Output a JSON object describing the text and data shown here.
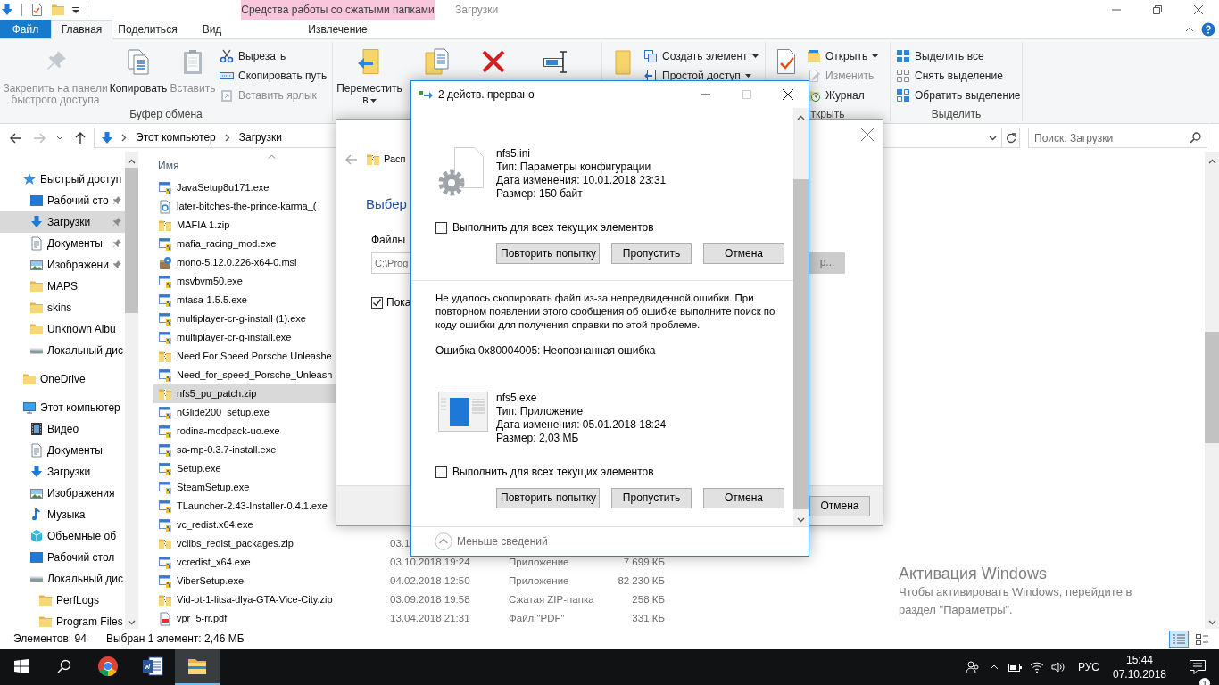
{
  "window": {
    "context_tab_group": "Средства работы со сжатыми папками",
    "title": "Загрузки"
  },
  "ribbon": {
    "tabs": [
      {
        "label": "Файл",
        "kind": "file",
        "selected": false
      },
      {
        "label": "Главная",
        "kind": "tab",
        "selected": true
      },
      {
        "label": "Поделиться",
        "kind": "tab",
        "selected": false
      },
      {
        "label": "Вид",
        "kind": "tab",
        "selected": false
      },
      {
        "label": "Извлечение",
        "kind": "context",
        "selected": false
      }
    ],
    "groups": [
      {
        "label": "Буфер обмена",
        "items": [
          {
            "kind": "large",
            "label": "Закрепить на панели быстрого доступа",
            "disabled": true,
            "dropdown": false
          },
          {
            "kind": "large",
            "label": "Копировать",
            "disabled": false,
            "dropdown": false
          },
          {
            "kind": "large",
            "label": "Вставить",
            "disabled": true,
            "dropdown": false
          },
          {
            "kind": "small",
            "label": "Вырезать",
            "disabled": false,
            "dropdown": false
          },
          {
            "kind": "small",
            "label": "Скопировать путь",
            "disabled": false,
            "dropdown": false
          },
          {
            "kind": "small",
            "label": "Вставить ярлык",
            "disabled": true,
            "dropdown": false
          }
        ]
      },
      {
        "items": [
          {
            "kind": "large",
            "label": "Переместить в",
            "disabled": false,
            "dropdown": true
          },
          {
            "kind": "large"
          },
          {
            "kind": "large"
          },
          {
            "kind": "large"
          }
        ]
      },
      {
        "items": [
          {
            "kind": "large"
          },
          {
            "kind": "small",
            "label": "Создать элемент",
            "disabled": false,
            "dropdown": true
          },
          {
            "kind": "small",
            "label": "Простой доступ",
            "disabled": false,
            "dropdown": true
          }
        ]
      },
      {
        "label": "ткрыть",
        "items": [
          {
            "kind": "large"
          },
          {
            "kind": "small",
            "label": "Открыть",
            "disabled": false,
            "dropdown": true
          },
          {
            "kind": "small",
            "label": "Изменить",
            "disabled": true,
            "dropdown": false
          },
          {
            "kind": "small",
            "label": "Журнал",
            "disabled": false,
            "dropdown": false
          }
        ]
      },
      {
        "label": "Выделить",
        "items": [
          {
            "kind": "small",
            "label": "Выделить все",
            "disabled": false,
            "dropdown": false
          },
          {
            "kind": "small",
            "label": "Снять выделение",
            "disabled": false,
            "dropdown": false
          },
          {
            "kind": "small",
            "label": "Обратить выделение",
            "disabled": false,
            "dropdown": false
          }
        ]
      }
    ]
  },
  "address": {
    "parts": [
      "Этот компьютер",
      "Загрузки"
    ],
    "search_placeholder": "Поиск: Загрузки"
  },
  "nav": {
    "items": [
      {
        "label": "Быстрый доступ",
        "kind": "star",
        "selected": false,
        "children": [
          {
            "label": "Рабочий сто",
            "kind": "desktop",
            "pinned": true,
            "selected": false
          },
          {
            "label": "Загрузки",
            "kind": "download",
            "pinned": true,
            "selected": true
          },
          {
            "label": "Документы",
            "kind": "documents",
            "pinned": true,
            "selected": false
          },
          {
            "label": "Изображени",
            "kind": "pictures",
            "pinned": true,
            "selected": false
          },
          {
            "label": "MAPS",
            "kind": "folder",
            "pinned": false,
            "selected": false
          },
          {
            "label": "skins",
            "kind": "folder",
            "pinned": false,
            "selected": false
          },
          {
            "label": "Unknown Albu",
            "kind": "folder",
            "pinned": false,
            "selected": false
          },
          {
            "label": "Локальный дис",
            "kind": "drive",
            "pinned": false,
            "selected": false
          }
        ]
      },
      {
        "label": "OneDrive",
        "kind": "folder",
        "selected": false
      },
      {
        "label": "Этот компьютер",
        "kind": "pc",
        "selected": false,
        "children": [
          {
            "label": "Видео",
            "kind": "video",
            "selected": false
          },
          {
            "label": "Документы",
            "kind": "documents",
            "selected": false
          },
          {
            "label": "Загрузки",
            "kind": "download",
            "selected": false
          },
          {
            "label": "Изображения",
            "kind": "pictures",
            "selected": false
          },
          {
            "label": "Музыка",
            "kind": "music",
            "selected": false
          },
          {
            "label": "Объемные об",
            "kind": "cube",
            "selected": false
          },
          {
            "label": "Рабочий стол",
            "kind": "desktop",
            "selected": false
          },
          {
            "label": "Локальный дис",
            "kind": "drive",
            "selected": false,
            "children": [
              {
                "label": "PerfLogs",
                "kind": "folder",
                "selected": false
              },
              {
                "label": "Program Files",
                "kind": "folder",
                "selected": false
              }
            ]
          }
        ]
      }
    ]
  },
  "file_list": {
    "name_column": "Имя"
  },
  "files": [
    {
      "name": "JavaSetup8u171.exe",
      "kind": "exe",
      "selected": false
    },
    {
      "name": "later-bitches-the-prince-karma_(",
      "kind": "web",
      "selected": false
    },
    {
      "name": "MAFIA 1.zip",
      "kind": "zip",
      "selected": false
    },
    {
      "name": "mafia_racing_mod.exe",
      "kind": "exe",
      "selected": false
    },
    {
      "name": "mono-5.12.0.226-x64-0.msi",
      "kind": "msi",
      "selected": false
    },
    {
      "name": "msvbvm50.exe",
      "kind": "exe",
      "selected": false
    },
    {
      "name": "mtasa-1.5.5.exe",
      "kind": "exe",
      "selected": false
    },
    {
      "name": "multiplayer-cr-g-install (1).exe",
      "kind": "exe",
      "selected": false
    },
    {
      "name": "multiplayer-cr-g-install.exe",
      "kind": "exe",
      "selected": false
    },
    {
      "name": "Need For Speed Porsche Unleashe",
      "kind": "zip",
      "selected": false
    },
    {
      "name": "Need_for_speed_Porsche_Unleash",
      "kind": "exe",
      "selected": false
    },
    {
      "name": "nfs5_pu_patch.zip",
      "kind": "zip",
      "selected": true
    },
    {
      "name": "nGlide200_setup.exe",
      "kind": "exe",
      "selected": false
    },
    {
      "name": "rodina-modpack-uo.exe",
      "kind": "exe",
      "selected": false
    },
    {
      "name": "sa-mp-0.3.7-install.exe",
      "kind": "exe",
      "selected": false
    },
    {
      "name": "Setup.exe",
      "kind": "exe",
      "selected": false
    },
    {
      "name": "SteamSetup.exe",
      "kind": "exe",
      "selected": false
    },
    {
      "name": "TLauncher-2.43-Installer-0.4.1.exe",
      "kind": "exe",
      "selected": false
    },
    {
      "name": "vc_redist.x64.exe",
      "kind": "exe",
      "selected": false
    },
    {
      "name": "vclibs_redist_packages.zip",
      "kind": "zip",
      "selected": false,
      "modified": "03.1"
    },
    {
      "name": "vcredist_x64.exe",
      "kind": "exe",
      "selected": false,
      "modified": "03.10.2018 19:24",
      "type": "Приложение",
      "size": "7 699 КБ"
    },
    {
      "name": "ViberSetup.exe",
      "kind": "exe",
      "selected": false,
      "modified": "04.02.2018 12:50",
      "type": "Приложение",
      "size": "82 230 КБ"
    },
    {
      "name": "Vid-ot-1-litsa-dlya-GTA-Vice-City.zip",
      "kind": "zip",
      "selected": false,
      "modified": "03.09.2018 19:58",
      "type": "Сжатая ZIP-папка",
      "size": "258 КБ"
    },
    {
      "name": "vpr_5-rr.pdf",
      "kind": "pdf",
      "selected": false,
      "modified": "13.04.2018 21:31",
      "type": "Файл \"PDF\"",
      "size": "331 КБ"
    }
  ],
  "status_bar": {
    "item_count": "Элементов: 94",
    "selection": "Выбран 1 элемент: 2,46 МБ",
    "views": [
      {
        "kind": "details",
        "selected": true
      },
      {
        "kind": "tiles",
        "selected": false
      }
    ]
  },
  "extract_wizard": {
    "header": "Расп",
    "heading": "Выбер",
    "files_label": "Файлы",
    "path": "C:\\Prog",
    "show_files": {
      "label": "Пока",
      "checked": true
    },
    "browse_button": "р...",
    "cancel_button": "Отмена"
  },
  "copy_dialog": {
    "title": "2 действ. прервано",
    "conflicts": [
      {
        "kind": "config",
        "name": "nfs5.ini",
        "type": "Тип: Параметры конфигурации",
        "modified": "Дата изменения: 10.01.2018 23:31",
        "size": "Размер: 150 байт",
        "apply_all": {
          "label": "Выполнить для всех текущих элементов",
          "checked": false
        },
        "buttons": [
          "Повторить попытку",
          "Пропустить",
          "Отмена"
        ]
      },
      {
        "kind": "app",
        "message": "Не удалось скопировать файл из-за непредвиденной ошибки. При повторном появлении этого сообщения об ошибке выполните поиск по коду ошибки для получения справки по этой проблеме.",
        "error": "Ошибка 0x80004005: Неопознанная ошибка",
        "name": "nfs5.exe",
        "type": "Тип: Приложение",
        "modified": "Дата изменения: 05.01.2018 18:24",
        "size": "Размер: 2,03 МБ",
        "apply_all": {
          "label": "Выполнить для всех текущих элементов",
          "checked": false
        },
        "buttons": [
          "Повторить попытку",
          "Пропустить",
          "Отмена"
        ]
      }
    ],
    "details_toggle": "Меньше сведений"
  },
  "activation_notice": {
    "title": "Активация Windows",
    "text": "Чтобы активировать Windows, перейдите в раздел \"Параметры\"."
  },
  "taskbar": {
    "apps": [
      {
        "kind": "browser",
        "active": false
      },
      {
        "kind": "word",
        "active": false
      },
      {
        "kind": "explorer",
        "active": true
      }
    ],
    "language": "РУС",
    "time": "15:44",
    "date": "07.10.2018",
    "notifications": "1"
  }
}
